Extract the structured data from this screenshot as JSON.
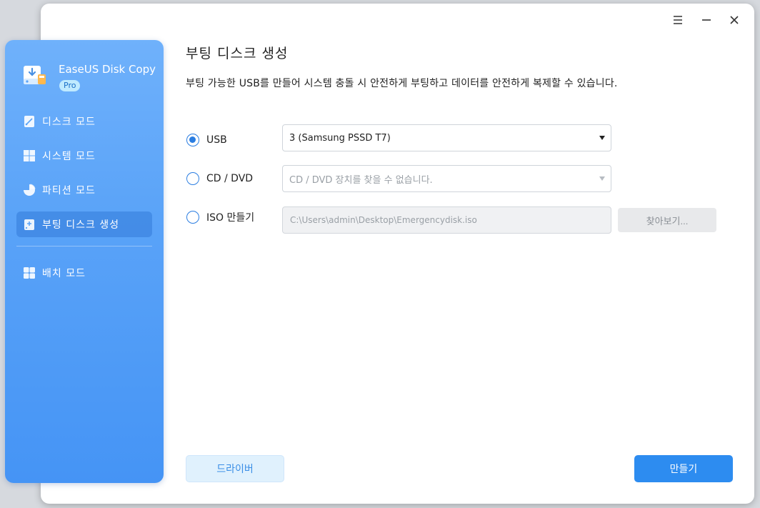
{
  "brand": {
    "name": "EaseUS Disk Copy",
    "badge": "Pro"
  },
  "sidebar": {
    "items": [
      {
        "label": "디스크 모드",
        "icon": "disk-icon",
        "active": false
      },
      {
        "label": "시스템 모드",
        "icon": "windows-icon",
        "active": false
      },
      {
        "label": "파티션 모드",
        "icon": "pie-chart-icon",
        "active": false
      },
      {
        "label": "부팅 디스크 생성",
        "icon": "bootable-disk-icon",
        "active": true
      }
    ],
    "bottom_items": [
      {
        "label": "배치 모드",
        "icon": "grid-icon"
      }
    ]
  },
  "window_controls": [
    "menu-icon",
    "minimize-icon",
    "close-icon"
  ],
  "main": {
    "title": "부팅 디스크 생성",
    "description": "부팅 가능한 USB를 만들어 시스템 충돌 시 안전하게 부팅하고 데이터를 안전하게 복제할 수 있습니다.",
    "options": [
      {
        "label": "USB",
        "checked": true,
        "value": "3 (Samsung PSSD T7)"
      },
      {
        "label": "CD / DVD",
        "checked": false,
        "value": "CD / DVD 장치를 찾을 수 없습니다."
      },
      {
        "label": "ISO 만들기",
        "checked": false,
        "value": "C:\\Users\\admin\\Desktop\\Emergencydisk.iso"
      }
    ],
    "browse_label": "찾아보기...",
    "driver_label": "드라이버",
    "create_label": "만들기"
  },
  "colors": {
    "accent": "#2d8cf0",
    "sidebar_top": "#6fb1fb",
    "sidebar_bottom": "#4594f5"
  }
}
